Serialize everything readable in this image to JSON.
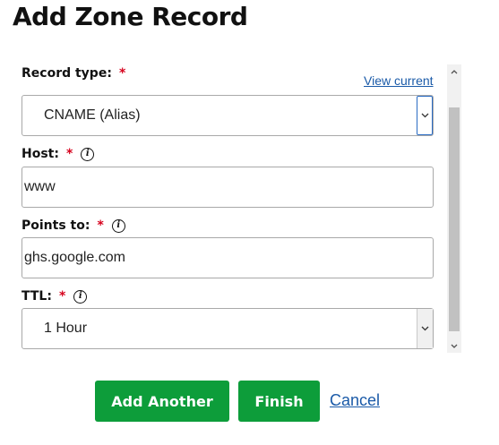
{
  "dialog": {
    "title": "Add Zone Record"
  },
  "form": {
    "record_type": {
      "label": "Record type:",
      "required_mark": "*",
      "view_current_link": "View current",
      "selected": "CNAME (Alias)",
      "dropdown_icon": "chevron-down"
    },
    "host": {
      "label": "Host:",
      "required_mark": "*",
      "info_icon": "i",
      "value": "www"
    },
    "points_to": {
      "label": "Points to:",
      "required_mark": "*",
      "info_icon": "i",
      "value": "ghs.google.com"
    },
    "ttl": {
      "label": "TTL:",
      "required_mark": "*",
      "info_icon": "i",
      "selected": "1 Hour",
      "dropdown_icon": "chevron-down"
    }
  },
  "actions": {
    "add_another_label": "Add Another",
    "finish_label": "Finish",
    "cancel_label": "Cancel"
  },
  "colors": {
    "primary_button": "#0d9d3a",
    "link": "#1a5aa8",
    "required": "#d6001c"
  }
}
